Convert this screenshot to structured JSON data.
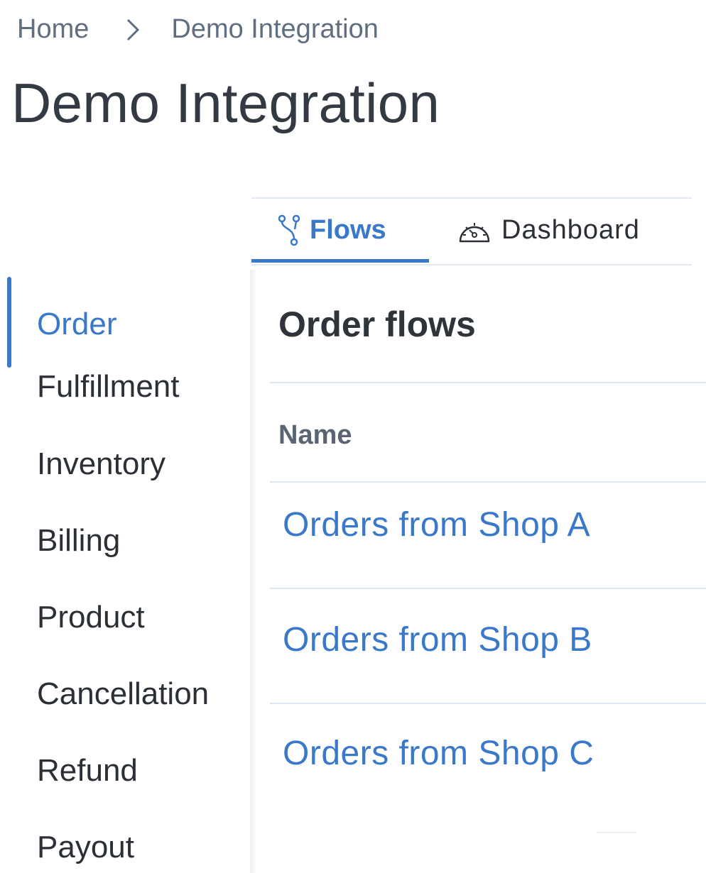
{
  "breadcrumb": {
    "items": [
      "Home",
      "Demo Integration"
    ]
  },
  "page": {
    "title": "Demo Integration"
  },
  "tabs": {
    "items": [
      {
        "label": "Flows",
        "icon": "flow-branch-icon",
        "active": true
      },
      {
        "label": "Dashboard",
        "icon": "gauge-icon",
        "active": false
      }
    ]
  },
  "sidebar": {
    "items": [
      {
        "label": "Order",
        "active": true
      },
      {
        "label": "Fulfillment"
      },
      {
        "label": "Inventory"
      },
      {
        "label": "Billing"
      },
      {
        "label": "Product"
      },
      {
        "label": "Cancellation"
      },
      {
        "label": "Refund"
      },
      {
        "label": "Payout"
      }
    ]
  },
  "main": {
    "section_title": "Order flows",
    "table": {
      "column_header": "Name",
      "rows": [
        "Orders from Shop A",
        "Orders from Shop B",
        "Orders from Shop C"
      ]
    }
  },
  "colors": {
    "accent": "#3a78c9",
    "text": "#2b2f36",
    "muted": "#5f6e80",
    "divider": "#dde6f0"
  }
}
